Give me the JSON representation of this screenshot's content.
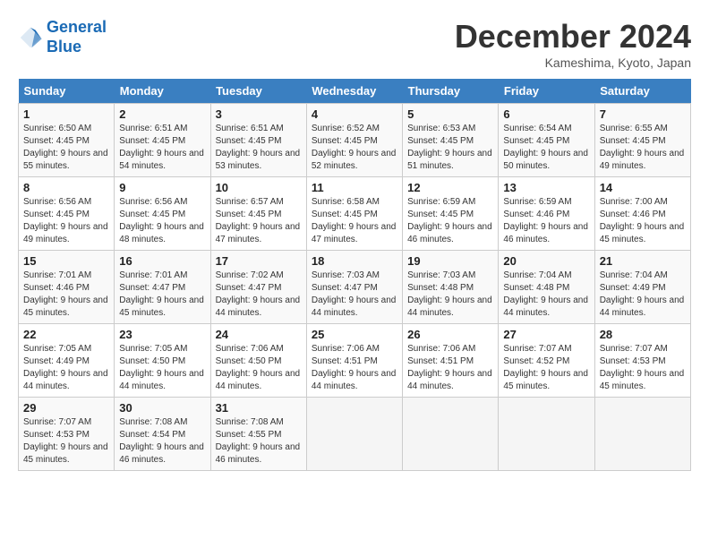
{
  "header": {
    "logo_line1": "General",
    "logo_line2": "Blue",
    "title": "December 2024",
    "location": "Kameshima, Kyoto, Japan"
  },
  "columns": [
    "Sunday",
    "Monday",
    "Tuesday",
    "Wednesday",
    "Thursday",
    "Friday",
    "Saturday"
  ],
  "weeks": [
    [
      {
        "day": "1",
        "sunrise": "Sunrise: 6:50 AM",
        "sunset": "Sunset: 4:45 PM",
        "daylight": "Daylight: 9 hours and 55 minutes."
      },
      {
        "day": "2",
        "sunrise": "Sunrise: 6:51 AM",
        "sunset": "Sunset: 4:45 PM",
        "daylight": "Daylight: 9 hours and 54 minutes."
      },
      {
        "day": "3",
        "sunrise": "Sunrise: 6:51 AM",
        "sunset": "Sunset: 4:45 PM",
        "daylight": "Daylight: 9 hours and 53 minutes."
      },
      {
        "day": "4",
        "sunrise": "Sunrise: 6:52 AM",
        "sunset": "Sunset: 4:45 PM",
        "daylight": "Daylight: 9 hours and 52 minutes."
      },
      {
        "day": "5",
        "sunrise": "Sunrise: 6:53 AM",
        "sunset": "Sunset: 4:45 PM",
        "daylight": "Daylight: 9 hours and 51 minutes."
      },
      {
        "day": "6",
        "sunrise": "Sunrise: 6:54 AM",
        "sunset": "Sunset: 4:45 PM",
        "daylight": "Daylight: 9 hours and 50 minutes."
      },
      {
        "day": "7",
        "sunrise": "Sunrise: 6:55 AM",
        "sunset": "Sunset: 4:45 PM",
        "daylight": "Daylight: 9 hours and 49 minutes."
      }
    ],
    [
      {
        "day": "8",
        "sunrise": "Sunrise: 6:56 AM",
        "sunset": "Sunset: 4:45 PM",
        "daylight": "Daylight: 9 hours and 49 minutes."
      },
      {
        "day": "9",
        "sunrise": "Sunrise: 6:56 AM",
        "sunset": "Sunset: 4:45 PM",
        "daylight": "Daylight: 9 hours and 48 minutes."
      },
      {
        "day": "10",
        "sunrise": "Sunrise: 6:57 AM",
        "sunset": "Sunset: 4:45 PM",
        "daylight": "Daylight: 9 hours and 47 minutes."
      },
      {
        "day": "11",
        "sunrise": "Sunrise: 6:58 AM",
        "sunset": "Sunset: 4:45 PM",
        "daylight": "Daylight: 9 hours and 47 minutes."
      },
      {
        "day": "12",
        "sunrise": "Sunrise: 6:59 AM",
        "sunset": "Sunset: 4:45 PM",
        "daylight": "Daylight: 9 hours and 46 minutes."
      },
      {
        "day": "13",
        "sunrise": "Sunrise: 6:59 AM",
        "sunset": "Sunset: 4:46 PM",
        "daylight": "Daylight: 9 hours and 46 minutes."
      },
      {
        "day": "14",
        "sunrise": "Sunrise: 7:00 AM",
        "sunset": "Sunset: 4:46 PM",
        "daylight": "Daylight: 9 hours and 45 minutes."
      }
    ],
    [
      {
        "day": "15",
        "sunrise": "Sunrise: 7:01 AM",
        "sunset": "Sunset: 4:46 PM",
        "daylight": "Daylight: 9 hours and 45 minutes."
      },
      {
        "day": "16",
        "sunrise": "Sunrise: 7:01 AM",
        "sunset": "Sunset: 4:47 PM",
        "daylight": "Daylight: 9 hours and 45 minutes."
      },
      {
        "day": "17",
        "sunrise": "Sunrise: 7:02 AM",
        "sunset": "Sunset: 4:47 PM",
        "daylight": "Daylight: 9 hours and 44 minutes."
      },
      {
        "day": "18",
        "sunrise": "Sunrise: 7:03 AM",
        "sunset": "Sunset: 4:47 PM",
        "daylight": "Daylight: 9 hours and 44 minutes."
      },
      {
        "day": "19",
        "sunrise": "Sunrise: 7:03 AM",
        "sunset": "Sunset: 4:48 PM",
        "daylight": "Daylight: 9 hours and 44 minutes."
      },
      {
        "day": "20",
        "sunrise": "Sunrise: 7:04 AM",
        "sunset": "Sunset: 4:48 PM",
        "daylight": "Daylight: 9 hours and 44 minutes."
      },
      {
        "day": "21",
        "sunrise": "Sunrise: 7:04 AM",
        "sunset": "Sunset: 4:49 PM",
        "daylight": "Daylight: 9 hours and 44 minutes."
      }
    ],
    [
      {
        "day": "22",
        "sunrise": "Sunrise: 7:05 AM",
        "sunset": "Sunset: 4:49 PM",
        "daylight": "Daylight: 9 hours and 44 minutes."
      },
      {
        "day": "23",
        "sunrise": "Sunrise: 7:05 AM",
        "sunset": "Sunset: 4:50 PM",
        "daylight": "Daylight: 9 hours and 44 minutes."
      },
      {
        "day": "24",
        "sunrise": "Sunrise: 7:06 AM",
        "sunset": "Sunset: 4:50 PM",
        "daylight": "Daylight: 9 hours and 44 minutes."
      },
      {
        "day": "25",
        "sunrise": "Sunrise: 7:06 AM",
        "sunset": "Sunset: 4:51 PM",
        "daylight": "Daylight: 9 hours and 44 minutes."
      },
      {
        "day": "26",
        "sunrise": "Sunrise: 7:06 AM",
        "sunset": "Sunset: 4:51 PM",
        "daylight": "Daylight: 9 hours and 44 minutes."
      },
      {
        "day": "27",
        "sunrise": "Sunrise: 7:07 AM",
        "sunset": "Sunset: 4:52 PM",
        "daylight": "Daylight: 9 hours and 45 minutes."
      },
      {
        "day": "28",
        "sunrise": "Sunrise: 7:07 AM",
        "sunset": "Sunset: 4:53 PM",
        "daylight": "Daylight: 9 hours and 45 minutes."
      }
    ],
    [
      {
        "day": "29",
        "sunrise": "Sunrise: 7:07 AM",
        "sunset": "Sunset: 4:53 PM",
        "daylight": "Daylight: 9 hours and 45 minutes."
      },
      {
        "day": "30",
        "sunrise": "Sunrise: 7:08 AM",
        "sunset": "Sunset: 4:54 PM",
        "daylight": "Daylight: 9 hours and 46 minutes."
      },
      {
        "day": "31",
        "sunrise": "Sunrise: 7:08 AM",
        "sunset": "Sunset: 4:55 PM",
        "daylight": "Daylight: 9 hours and 46 minutes."
      },
      null,
      null,
      null,
      null
    ]
  ]
}
